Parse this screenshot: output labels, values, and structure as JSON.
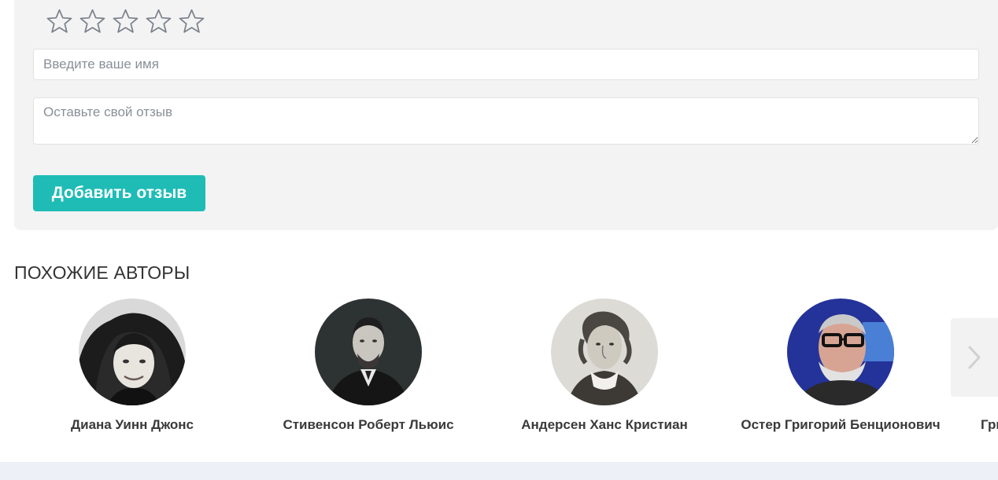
{
  "review_form": {
    "stars": [
      {
        "icon": "star-outline-icon"
      },
      {
        "icon": "star-outline-icon"
      },
      {
        "icon": "star-outline-icon"
      },
      {
        "icon": "star-outline-icon"
      },
      {
        "icon": "star-outline-icon"
      }
    ],
    "name_placeholder": "Введите ваше имя",
    "name_value": "",
    "review_placeholder": "Оставьте свой отзыв",
    "review_value": "",
    "submit_label": "Добавить отзыв",
    "accent_color": "#1fbcb6"
  },
  "similar_authors": {
    "title": "ПОХОЖИЕ АВТОРЫ",
    "authors": [
      {
        "name": "Диана Уинн Джонс"
      },
      {
        "name": "Стивенсон Роберт Льюис"
      },
      {
        "name": "Андерсен Ханс Кристиан"
      },
      {
        "name": "Остер Григорий Бенционович"
      },
      {
        "name": "Гри"
      }
    ],
    "next_icon": "chevron-right-icon"
  }
}
